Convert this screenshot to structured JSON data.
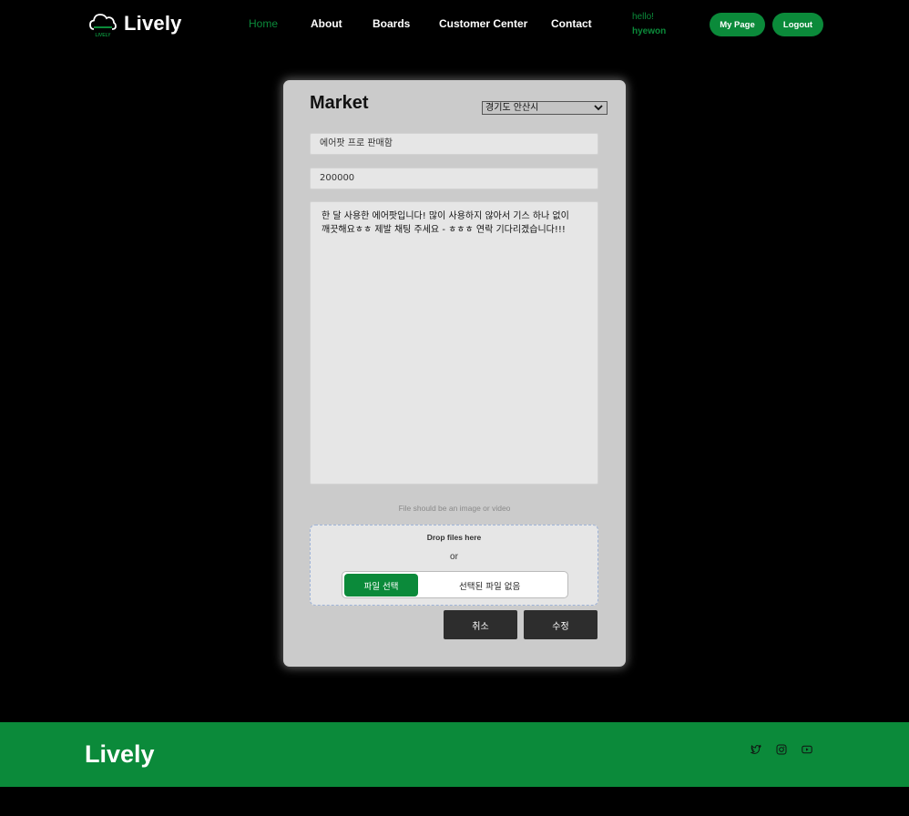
{
  "brand": {
    "name": "Lively",
    "icon_label": "LIVELY",
    "accent": "#0b8a3a"
  },
  "nav": {
    "home": "Home",
    "about": "About",
    "boards": "Boards",
    "customer_center": "Customer Center",
    "contact": "Contact"
  },
  "user": {
    "greeting": "hello!",
    "name": "hyewon",
    "mypage_label": "My Page",
    "logout_label": "Logout"
  },
  "form": {
    "title": "Market",
    "region": "경기도 안산시",
    "post_title": "에어팟 프로 판매함",
    "price": "200000",
    "content": "한 달 사용한 에어팟입니다! 많이 사용하지 않아서 기스 하나 없이 깨끗해요ㅎㅎ 제발 채팅 주세요 - ㅎㅎㅎ 연락 기다리겠습니다!!!",
    "file_hint": "File should be an image or video",
    "drop_text": "Drop files here",
    "or_text": "or",
    "file_button": "파일 선택",
    "file_status": "선택된 파일 없음",
    "cancel_label": "취소",
    "submit_label": "수정"
  },
  "footer": {
    "logo": "Lively",
    "social_icons": [
      "twitter-icon",
      "instagram-icon",
      "youtube-icon"
    ]
  }
}
